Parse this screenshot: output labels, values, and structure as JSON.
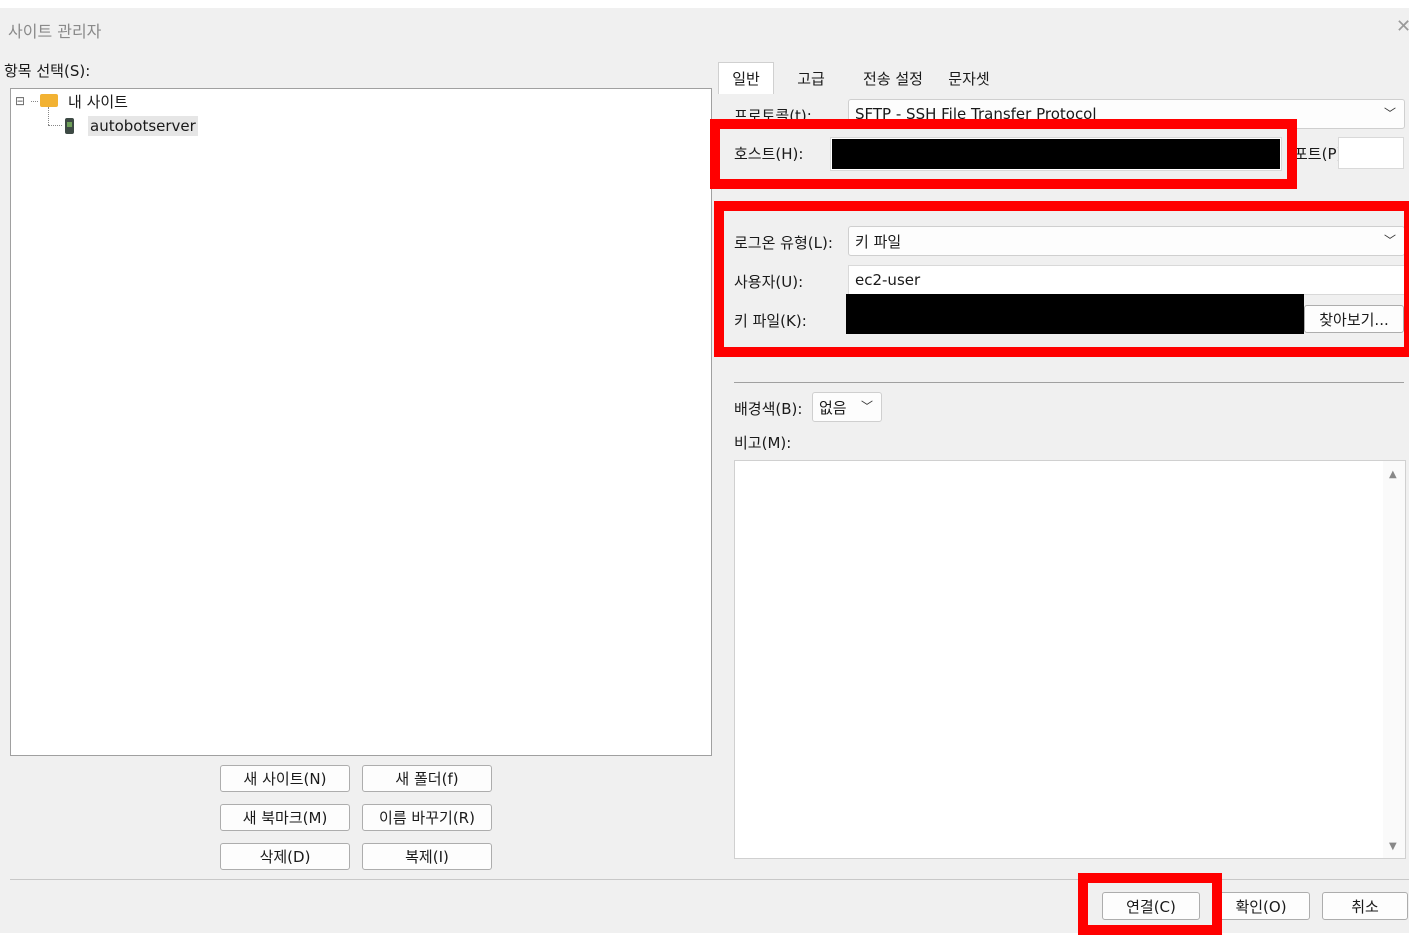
{
  "window": {
    "title": "사이트 관리자",
    "close_glyph": "✕"
  },
  "left": {
    "select_label": "항목 선택(S):",
    "tree": {
      "root_label": "내 사이트",
      "child_label": "autobotserver",
      "expander_glyph": "⊟"
    },
    "buttons": {
      "new_site": "새 사이트(N)",
      "new_folder": "새 폴더(f)",
      "new_bookmark": "새 북마크(M)",
      "rename": "이름 바꾸기(R)",
      "delete": "삭제(D)",
      "duplicate": "복제(I)"
    }
  },
  "tabs": [
    {
      "label": "일반",
      "active": true
    },
    {
      "label": "고급",
      "active": false
    },
    {
      "label": "전송 설정",
      "active": false
    },
    {
      "label": "문자셋",
      "active": false
    }
  ],
  "general": {
    "protocol_label": "프로토콜(t):",
    "protocol_value": "SFTP - SSH File Transfer Protocol",
    "host_label": "호스트(H):",
    "port_label": "포트(P):",
    "logon_type_label": "로그온 유형(L):",
    "logon_type_value": "키 파일",
    "user_label": "사용자(U):",
    "user_value": "ec2-user",
    "keyfile_label": "키 파일(K):",
    "browse_button": "찾아보기...",
    "bgcolor_label": "배경색(B):",
    "bgcolor_value": "없음",
    "comments_label": "비고(M):"
  },
  "footer": {
    "connect": "연결(C)",
    "ok": "확인(O)",
    "cancel": "취소"
  },
  "colors": {
    "highlight": "#ff0000",
    "redaction": "#000000",
    "folder": "#f2b233"
  },
  "icons": [
    "folder-icon",
    "server-icon",
    "chevron-down-icon",
    "close-icon",
    "scroll-up-icon",
    "scroll-down-icon"
  ]
}
